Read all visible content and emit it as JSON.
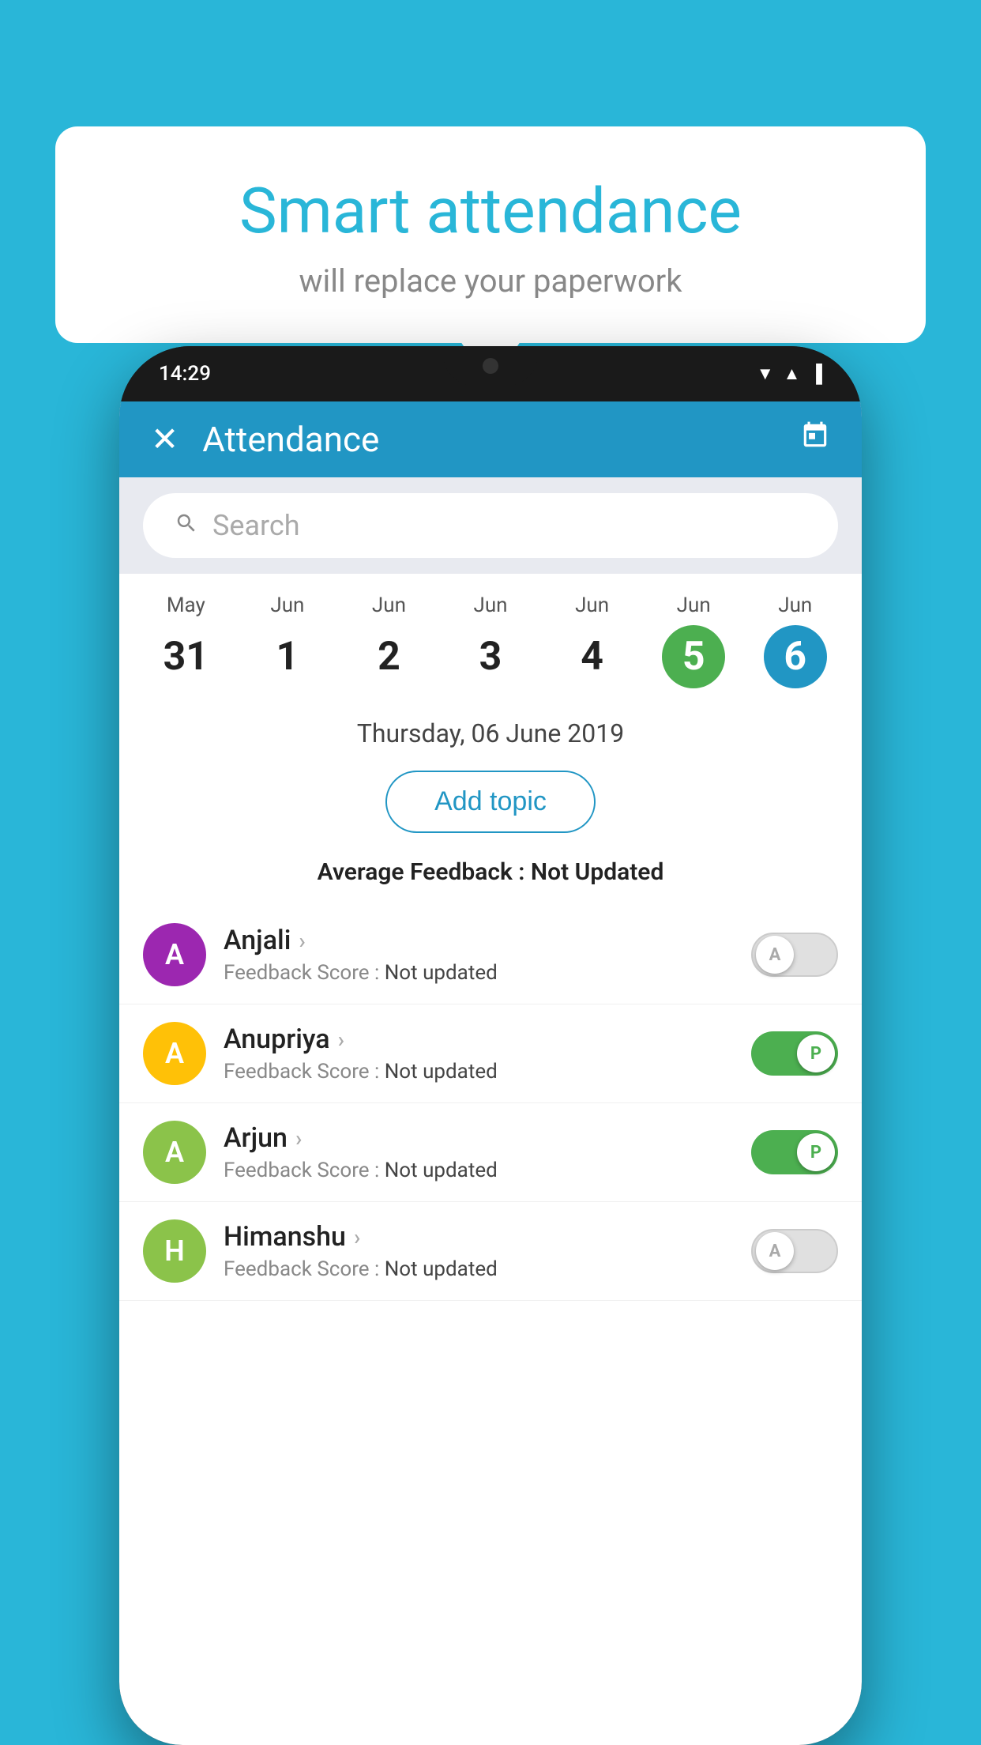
{
  "background_color": "#29b6d8",
  "speech_bubble": {
    "title": "Smart attendance",
    "subtitle": "will replace your paperwork"
  },
  "status_bar": {
    "time": "14:29",
    "wifi": "▼",
    "signal": "▲",
    "battery": "▪"
  },
  "app_header": {
    "title": "Attendance",
    "close_label": "✕",
    "calendar_icon": "📅"
  },
  "search": {
    "placeholder": "Search"
  },
  "calendar": {
    "days": [
      {
        "month": "May",
        "date": "31",
        "style": "normal"
      },
      {
        "month": "Jun",
        "date": "1",
        "style": "normal"
      },
      {
        "month": "Jun",
        "date": "2",
        "style": "normal"
      },
      {
        "month": "Jun",
        "date": "3",
        "style": "normal"
      },
      {
        "month": "Jun",
        "date": "4",
        "style": "normal"
      },
      {
        "month": "Jun",
        "date": "5",
        "style": "today"
      },
      {
        "month": "Jun",
        "date": "6",
        "style": "selected"
      }
    ]
  },
  "selected_date_label": "Thursday, 06 June 2019",
  "add_topic_label": "Add topic",
  "avg_feedback_label": "Average Feedback :",
  "avg_feedback_value": "Not Updated",
  "students": [
    {
      "name": "Anjali",
      "avatar_letter": "A",
      "avatar_color": "#9C27B0",
      "feedback_label": "Feedback Score :",
      "feedback_value": "Not updated",
      "toggle_state": "off",
      "toggle_label": "A"
    },
    {
      "name": "Anupriya",
      "avatar_letter": "A",
      "avatar_color": "#FFC107",
      "feedback_label": "Feedback Score :",
      "feedback_value": "Not updated",
      "toggle_state": "on",
      "toggle_label": "P"
    },
    {
      "name": "Arjun",
      "avatar_letter": "A",
      "avatar_color": "#8BC34A",
      "feedback_label": "Feedback Score :",
      "feedback_value": "Not updated",
      "toggle_state": "on",
      "toggle_label": "P"
    },
    {
      "name": "Himanshu",
      "avatar_letter": "H",
      "avatar_color": "#8BC34A",
      "feedback_label": "Feedback Score :",
      "feedback_value": "Not updated",
      "toggle_state": "off",
      "toggle_label": "A"
    }
  ]
}
